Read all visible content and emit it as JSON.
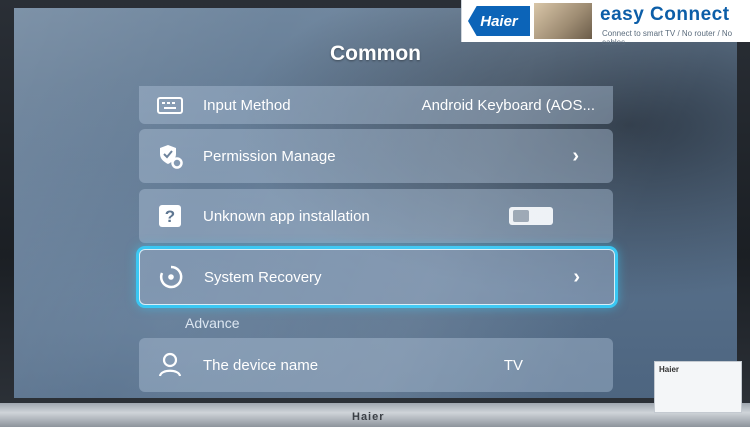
{
  "screen": {
    "title": "Common"
  },
  "rows": [
    {
      "label": "Input Method",
      "value": "Android Keyboard (AOS...",
      "icon": "keyboard-icon"
    },
    {
      "label": "Permission Manage",
      "icon": "shield-gear-icon"
    },
    {
      "label": "Unknown app installation",
      "icon": "question-icon",
      "toggle": "off"
    },
    {
      "label": "System Recovery",
      "icon": "recovery-icon",
      "selected": true
    },
    {
      "label": "The device name",
      "value": "TV",
      "icon": "person-icon"
    }
  ],
  "section": {
    "advance": "Advance"
  },
  "branding": {
    "logo": "Haier",
    "title": "easy Connect",
    "subtitle": "Connect to smart TV / No router / No cables",
    "bottom_logo": "Haier",
    "sticker_logo": "Haier"
  },
  "colors": {
    "focus": "#39c7f3",
    "brand": "#0c64b8"
  }
}
